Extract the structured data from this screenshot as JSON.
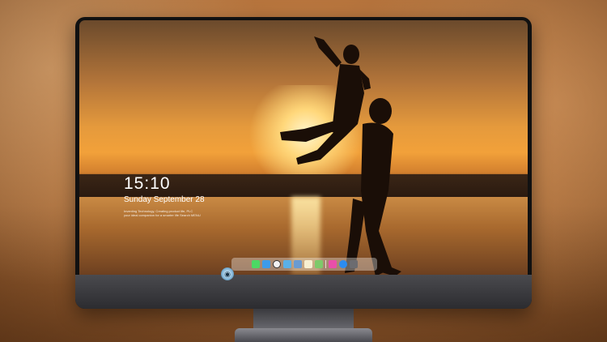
{
  "lock_screen": {
    "time": "15:10",
    "date": "Sunday September 28",
    "caption_line1": "Inventing Technology, Creating product life, PLC",
    "caption_line2": "your ideal companion for a smarter life Search MENU"
  },
  "dock": {
    "apps": [
      {
        "icon": "messages-icon",
        "color": "#4cd964"
      },
      {
        "icon": "weather-icon",
        "color": "#3d9bea"
      },
      {
        "icon": "clock-icon",
        "color": "#f2f2f2"
      },
      {
        "icon": "finder-icon",
        "color": "#5ab0e8"
      },
      {
        "icon": "clapper-icon",
        "color": "#6a9bd1"
      },
      {
        "icon": "notes-icon",
        "color": "#f7f0d2"
      },
      {
        "icon": "photos-icon",
        "color": "#7ec96a"
      },
      {
        "icon": "music-icon",
        "color": "#e94fa9"
      },
      {
        "icon": "app-store-icon",
        "color": "#2b8cf0"
      },
      {
        "icon": "camera-icon",
        "color": "#6c6c70"
      }
    ]
  },
  "monitor": {
    "logo_glyph": "◉"
  }
}
